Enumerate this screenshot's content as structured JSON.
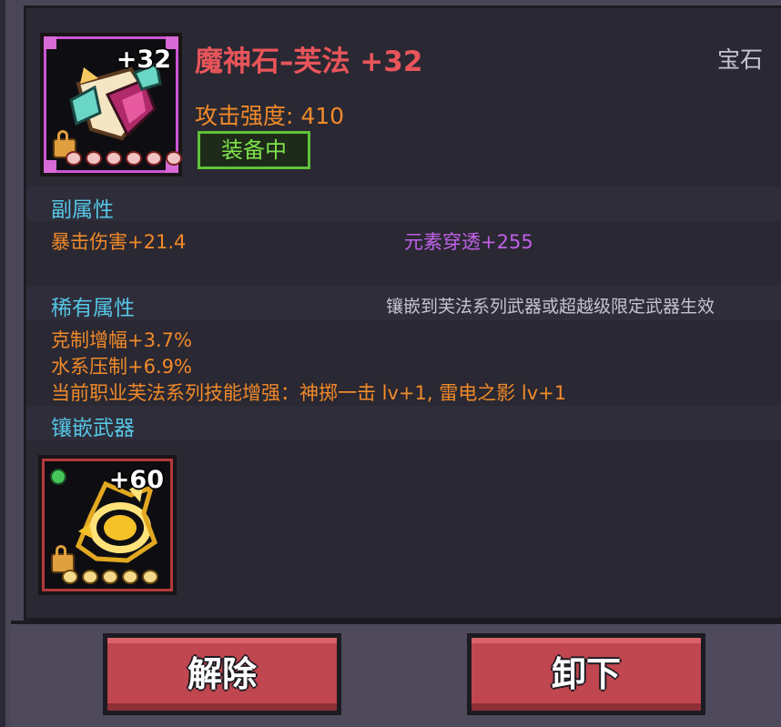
{
  "item": {
    "name": "魔神石–芙法 +32",
    "category": "宝石",
    "plus": "+32",
    "attack": "攻击强度: 410",
    "status": "装备中",
    "icon": "crystal-gem-icon",
    "star_count": 6
  },
  "sub_attributes": {
    "header": "副属性",
    "left": "暴击伤害+21.4",
    "right": "元素穿透+255"
  },
  "rare_attributes": {
    "header": "稀有属性",
    "hint": "镶嵌到芙法系列武器或超越级限定武器生效",
    "lines": [
      "克制增幅+3.7%",
      "水系压制+6.9%",
      "当前职业芙法系列技能增强：神掷一击 lv+1, 雷电之影 lv+1"
    ]
  },
  "inlay": {
    "header": "镶嵌武器",
    "weapon_plus": "+60",
    "weapon_icon": "golden-weapon-icon",
    "star_count": 5
  },
  "buttons": {
    "remove": "解除",
    "unequip": "卸下"
  },
  "colors": {
    "title": "#e8555a",
    "accent_orange": "#f08a2a",
    "accent_purple": "#c061e8",
    "section_cyan": "#56c6e6",
    "equipped_green": "#7ee14a",
    "button_red": "#c0464f"
  }
}
